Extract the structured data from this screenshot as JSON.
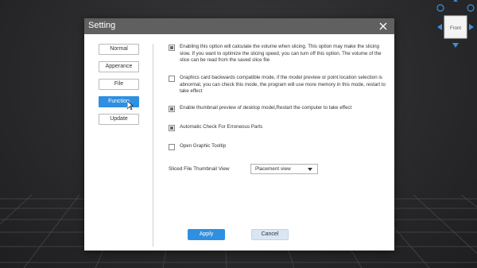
{
  "dialog": {
    "title": "Setting",
    "close_icon": "close-icon"
  },
  "nav": {
    "items": [
      {
        "label": "Normal"
      },
      {
        "label": "Apperance"
      },
      {
        "label": "File"
      },
      {
        "label": "Function",
        "active": true
      },
      {
        "label": "Update"
      }
    ]
  },
  "options": [
    {
      "checked": true,
      "text": "Enabling this option will calculate the volume when slicing. This option may make the slicing slow. If you want to optimize the slicing speed, you can turn off this option. The volume of the slice can be read from the saved slice file"
    },
    {
      "checked": false,
      "text": "Graphics card backwards compatible mode, if the model preview or point location selection is abnormal, you can check this mode, the program will use more memory in this mode, restart to take effect"
    },
    {
      "checked": true,
      "text": "Enable thumbnail preview of desktop model,Restart the computer to take effect"
    },
    {
      "checked": true,
      "text": "Automatic Check For Erroneous Parts"
    },
    {
      "checked": false,
      "text": "Open Graphic Tooltip"
    }
  ],
  "thumbnail": {
    "label": "Sliced File Thumbnail View",
    "selected": "Placement view"
  },
  "footer": {
    "apply_label": "Apply",
    "cancel_label": "Cancel"
  },
  "viewcube": {
    "face_label": "Front"
  },
  "colors": {
    "accent": "#2f8fe0",
    "titlebar": "#606060"
  }
}
